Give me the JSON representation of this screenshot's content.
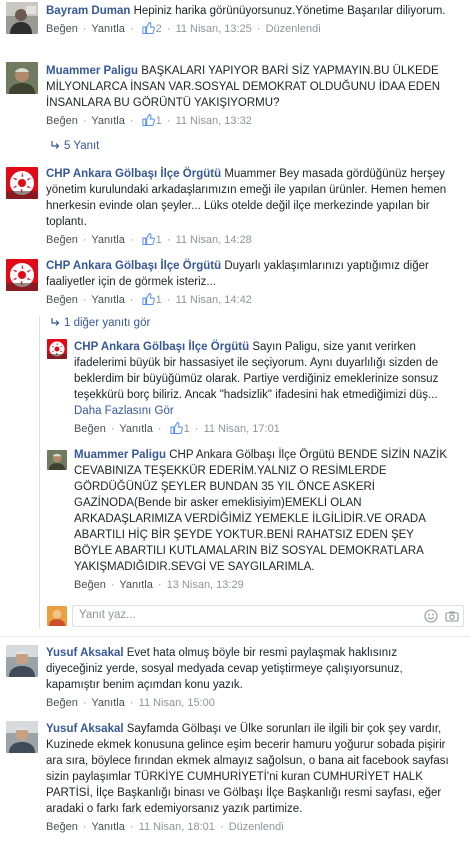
{
  "labels": {
    "like": "Beğen",
    "reply": "Yanıtla",
    "edited": "Düzenlendi",
    "see_more": "Daha Fazlasını Gör",
    "sep": "·"
  },
  "comments": [
    {
      "author": "Bayram Duman",
      "text": "Hepiniz harika görünüyorsunuz.Yönetime Başarılar diliyorum.",
      "likes": "2",
      "date": "11 Nisan, 13:25",
      "avatar": "person-avatar-1"
    },
    {
      "author": "Muammer Paligu",
      "text": "BAŞKALARI YAPIYOR BARİ SİZ YAPMAYIN.BU ÜLKEDE MİLYONLARCA İNSAN VAR.SOSYAL DEMOKRAT OLDUĞUNU İDAA EDEN İNSANLARA BU GÖRÜNTÜ YAKIŞIYORMU?",
      "likes": "1",
      "date": "11 Nisan, 13:32",
      "replies_link": "5 Yanıt"
    },
    {
      "author": "CHP Ankara Gölbaşı İlçe Örgütü",
      "text": "Muammer Bey masada gördüğünüz herşey yönetim kurulundaki arkadaşlarımızın emeği ile yapılan ürünler. Hemen hemen hnerkesin evinde olan şeyler... Lüks otelde değil ilçe merkezinde yapılan bir toplantı.",
      "likes": "1",
      "date": "11 Nisan, 14:28"
    },
    {
      "author": "CHP Ankara Gölbaşı İlçe Örgütü",
      "text": "Duyarlı yaklaşımlarınızı yaptığımız diğer faaliyetler için de görmek isteriz...",
      "likes": "1",
      "date": "11 Nisan, 14:42",
      "replies_link": "1 diğer yanıtı gör"
    }
  ],
  "replies": [
    {
      "author": "CHP Ankara Gölbaşı İlçe Örgütü",
      "text": "Sayın Paligu, size yanıt verirken ifadelerimi büyük bir hassasiyet ile seçiyorum. Aynı duyarlılığı sizden de beklerdim bir büyüğümüz olarak. Partiye verdiğiniz emeklerinize sonsuz teşekkürü borç biliriz. Ancak \"hadsizlik\" ifadesini hak etmediğimizi düş...",
      "likes": "1",
      "date": "11 Nisan, 17:01"
    },
    {
      "author": "Muammer Paligu",
      "text": "CHP Ankara Gölbaşı İlçe Örgütü BENDE SİZİN NAZİK CEVABINIZA TEŞEKKÜR EDERİM.YALNIZ O RESİMLERDE GÖRDÜĞÜNÜZ ŞEYLER BUNDAN 35 YIL ÖNCE ASKERİ GAZİNODA(Bende bir asker emeklisiyim)EMEKLİ OLAN ARKADAŞLARIMIZA VERDİĞİMİZ YEMEKLE İLGİLİDİR.VE ORADA ABARTILI HİÇ BİR ŞEYDE YOKTUR.BENİ RAHATSIZ EDEN ŞEY BÖYLE ABARTILI KUTLAMALARIN BİZ SOSYAL DEMOKRATLARA YAKIŞMADIĞIDIR.SEVGİ VE SAYGILARIMLA.",
      "date": "13 Nisan, 13:29"
    }
  ],
  "reply_input": {
    "placeholder": "Yanıt yaz..."
  },
  "comments_after": [
    {
      "author": "Yusuf Aksakal",
      "text": "Evet hata olmuş böyle bir resmi paylaşmak haklısınız diyeceğiniz yerde, sosyal medyada cevap yetiştirmeye çalışıyorsunuz, kapamıştır benim açımdan konu yazık.",
      "date": "11 Nisan, 15:00"
    },
    {
      "author": "Yusuf Aksakal",
      "text": "Sayfamda Gölbaşı ve Ülke sorunları ile ilgili bir çok şey vardır, Kuzinede ekmek konusuna gelince eşim becerir hamuru yoğurur sobada pişirir ara sıra, böylece fırından ekmek almayız sağolsun, o bana ait facebook sayfası sizin paylaşımlar TÜRKİYE CUMHURİYETİ'ni kuran CUMHURİYET HALK PARTİSİ, İlçe Başkanlığı binası ve Gölbaşı İlçe Başkanlığı resmi sayfası, eğer aradaki o farkı fark edemiyorsanız yazık partimize.",
      "date": "11 Nisan, 18:01"
    }
  ],
  "colors": {
    "link": "#365899",
    "meta": "#90949c",
    "text": "#1d2129",
    "chp_red": "#e30a17"
  }
}
